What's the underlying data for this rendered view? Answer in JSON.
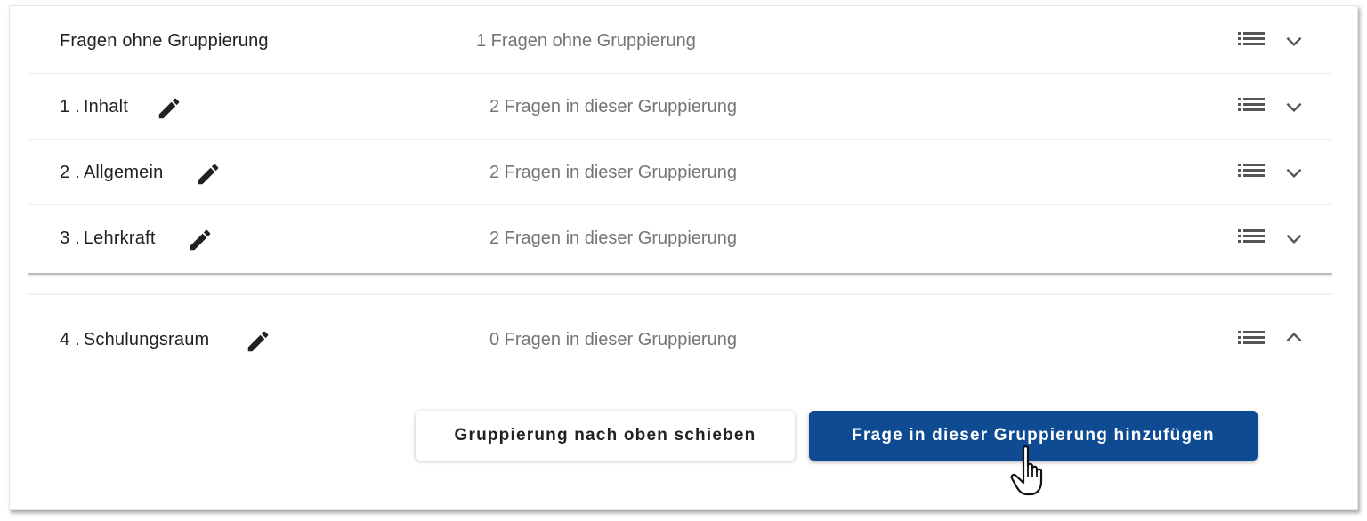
{
  "groups": [
    {
      "number": "",
      "name": "Fragen ohne Gruppierung",
      "summary": "1 Fragen ohne Gruppierung",
      "editable": false,
      "expanded": false
    },
    {
      "number": "1 .",
      "name": "Inhalt",
      "summary": "2 Fragen in dieser Gruppierung",
      "editable": true,
      "expanded": false
    },
    {
      "number": "2 .",
      "name": "Allgemein",
      "summary": "2 Fragen in dieser Gruppierung",
      "editable": true,
      "expanded": false
    },
    {
      "number": "3 .",
      "name": "Lehrkraft",
      "summary": "2 Fragen in dieser Gruppierung",
      "editable": true,
      "expanded": false
    },
    {
      "number": "4 .",
      "name": "Schulungsraum",
      "summary": "0 Fragen in dieser Gruppierung",
      "editable": true,
      "expanded": true
    }
  ],
  "actions": {
    "move_up_label": "Gruppierung nach oben schieben",
    "add_question_label": "Frage in dieser Gruppierung hinzufügen"
  },
  "icons": {
    "edit": "pencil-icon",
    "list": "list-icon",
    "collapse": "chevron-down-icon",
    "expand": "chevron-up-icon",
    "cursor": "hand-pointer-icon"
  },
  "colors": {
    "primary": "#0f4b93",
    "text": "#212121",
    "muted": "#757575",
    "icon": "#555555"
  }
}
